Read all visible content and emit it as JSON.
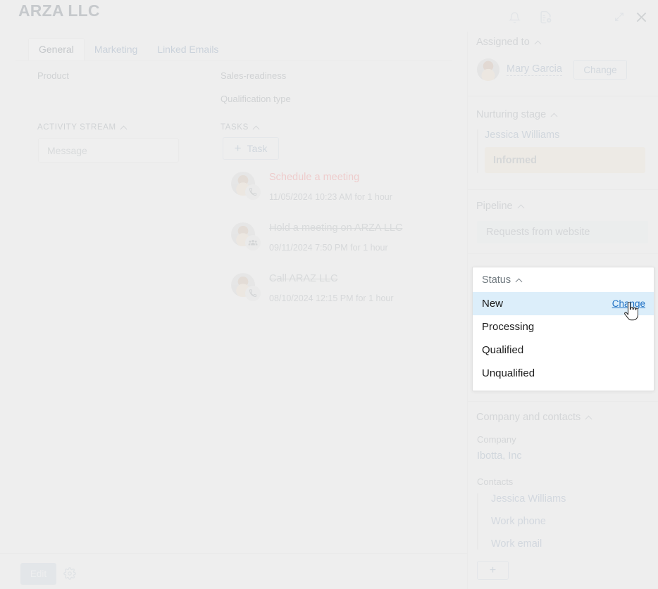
{
  "page": {
    "title": "ARZA LLC"
  },
  "tabs": [
    {
      "label": "General",
      "active": true
    },
    {
      "label": "Marketing",
      "active": false
    },
    {
      "label": "Linked Emails",
      "active": false
    }
  ],
  "fields": {
    "product_label": "Product",
    "sales_readiness_label": "Sales-readiness",
    "qualification_type_label": "Qualification type"
  },
  "activity_stream": {
    "header": "ACTIVITY STREAM",
    "message_placeholder": "Message"
  },
  "tasks_section": {
    "header": "TASKS",
    "add_button_label": "Task",
    "add_button_icon": "plus-icon",
    "items": [
      {
        "title": "Schedule a meeting",
        "date": "11/05/2024 10:23 AM for 1 hour",
        "state": "pending",
        "badge_icon": "phone-icon"
      },
      {
        "title": "Hold a meeting on ARZA LLC",
        "date": "09/11/2024 7:50 PM for 1 hour",
        "state": "done",
        "badge_icon": "group-icon"
      },
      {
        "title": "Call ARAZ LLC",
        "date": "08/10/2024 12:15 PM for 1 hour",
        "state": "done",
        "badge_icon": "phone-icon"
      }
    ]
  },
  "footer": {
    "edit_label": "Edit",
    "settings_icon": "gear-icon"
  },
  "topbar": {
    "icons": [
      {
        "name": "bell-icon"
      },
      {
        "name": "document-add-icon"
      },
      {
        "name": "expand-icon"
      },
      {
        "name": "close-icon"
      }
    ]
  },
  "right_panel": {
    "assigned_to": {
      "header": "Assigned to",
      "person": "Mary Garcia",
      "change_label": "Change"
    },
    "nurturing_stage": {
      "header": "Nurturing stage",
      "person": "Jessica Williams",
      "stage": "Informed",
      "stage_color": "#ece3d2"
    },
    "pipeline": {
      "header": "Pipeline",
      "value": "Requests from website",
      "value_bg": "#e6ebed"
    },
    "status": {
      "header": "Status",
      "selected": "New",
      "change_label": "Change",
      "highlight_color": "#dceefa",
      "link_color": "#1b6fc4",
      "options": [
        "New",
        "Processing",
        "Qualified",
        "Unqualified"
      ]
    },
    "company_and_contacts": {
      "header": "Company and contacts",
      "company_label": "Company",
      "company_value": "Ibotta, Inc",
      "contacts_label": "Contacts",
      "contacts": [
        "Jessica Williams",
        "Work phone",
        "Work email"
      ],
      "add_label": "+"
    }
  }
}
